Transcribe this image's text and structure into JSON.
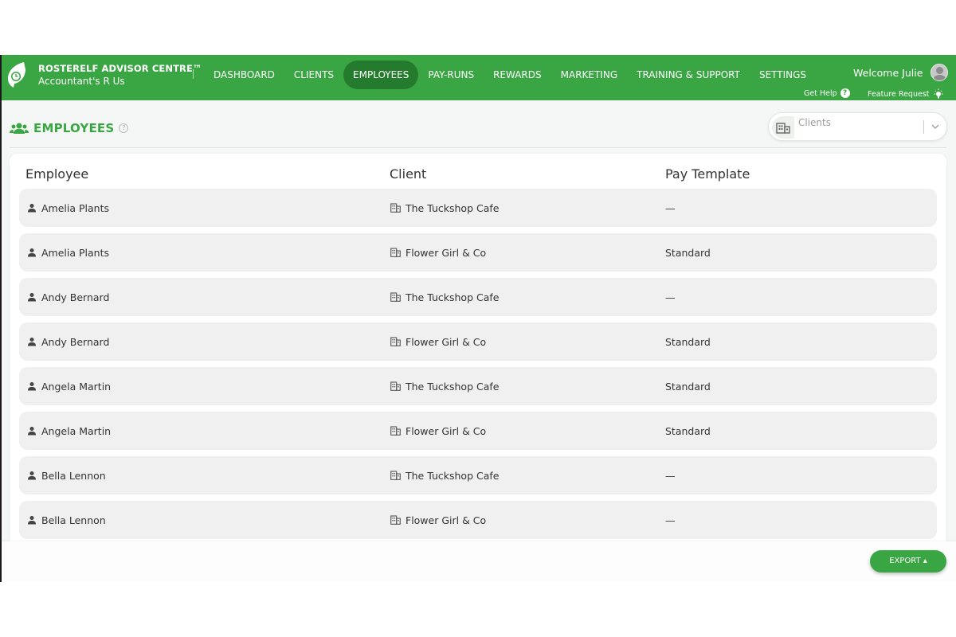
{
  "brand": {
    "title": "ROSTERELF ADVISOR CENTRE™",
    "subtitle": "Accountant's R Us"
  },
  "nav": [
    {
      "label": "DASHBOARD",
      "active": false
    },
    {
      "label": "CLIENTS",
      "active": false
    },
    {
      "label": "EMPLOYEES",
      "active": true
    },
    {
      "label": "PAY-RUNS",
      "active": false
    },
    {
      "label": "REWARDS",
      "active": false
    },
    {
      "label": "MARKETING",
      "active": false
    },
    {
      "label": "TRAINING & SUPPORT",
      "active": false
    },
    {
      "label": "SETTINGS",
      "active": false
    }
  ],
  "user": {
    "welcome": "Welcome Julie"
  },
  "help": {
    "get_help": "Get Help",
    "feature_request": "Feature Request"
  },
  "page": {
    "title": "EMPLOYEES"
  },
  "filter": {
    "placeholder": "Clients"
  },
  "table": {
    "headers": {
      "employee": "Employee",
      "client": "Client",
      "pay_template": "Pay Template"
    },
    "rows": [
      {
        "employee": "Amelia Plants",
        "client": "The Tuckshop Cafe",
        "pay_template": "—"
      },
      {
        "employee": "Amelia Plants",
        "client": "Flower Girl & Co",
        "pay_template": "Standard"
      },
      {
        "employee": "Andy Bernard",
        "client": "The Tuckshop Cafe",
        "pay_template": "—"
      },
      {
        "employee": "Andy Bernard",
        "client": "Flower Girl & Co",
        "pay_template": "Standard"
      },
      {
        "employee": "Angela Martin",
        "client": "The Tuckshop Cafe",
        "pay_template": "Standard"
      },
      {
        "employee": "Angela Martin",
        "client": "Flower Girl & Co",
        "pay_template": "Standard"
      },
      {
        "employee": "Bella Lennon",
        "client": "The Tuckshop Cafe",
        "pay_template": "—"
      },
      {
        "employee": "Bella Lennon",
        "client": "Flower Girl & Co",
        "pay_template": "—"
      }
    ]
  },
  "footer": {
    "export_label": "EXPORT ▴"
  },
  "colors": {
    "brand_green": "#3aa543",
    "nav_active": "#247a2d",
    "row_bg": "#eff0ef"
  }
}
